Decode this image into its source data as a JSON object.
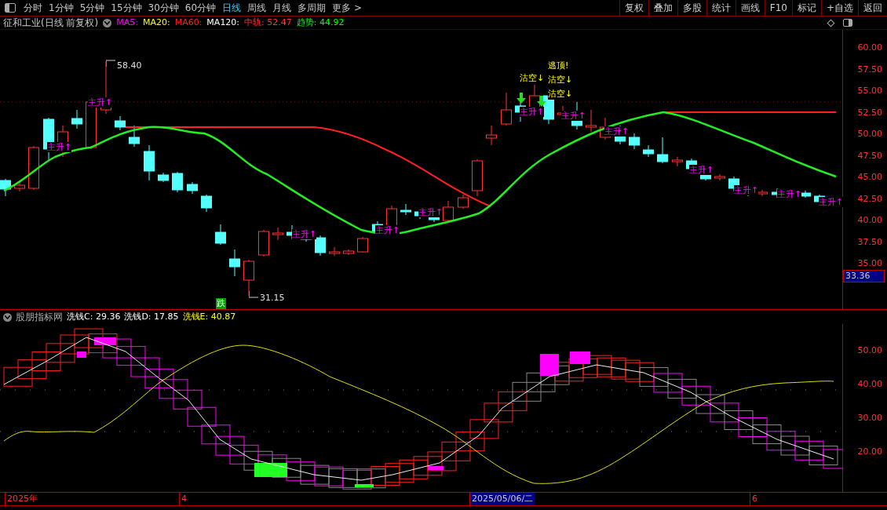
{
  "toolbar": {
    "periods": [
      {
        "label": "分时",
        "selected": false
      },
      {
        "label": "1分钟",
        "selected": false
      },
      {
        "label": "5分钟",
        "selected": false
      },
      {
        "label": "15分钟",
        "selected": false
      },
      {
        "label": "30分钟",
        "selected": false
      },
      {
        "label": "60分钟",
        "selected": false
      },
      {
        "label": "日线",
        "selected": true
      },
      {
        "label": "周线",
        "selected": false
      },
      {
        "label": "月线",
        "selected": false
      },
      {
        "label": "多周期",
        "selected": false
      }
    ],
    "more": "更多 >",
    "actions": [
      "复权",
      "叠加",
      "多股",
      "统计",
      "画线",
      "F10",
      "标记",
      "+自选",
      "返回"
    ]
  },
  "price_chart": {
    "title": "征和工业(日线 前复权)",
    "indicators": [
      {
        "label": "MA5:",
        "color": "#ff00ff"
      },
      {
        "label": "MA20:",
        "color": "#ffff00"
      },
      {
        "label": "MA60:",
        "color": "#ff2020"
      },
      {
        "label": "MA120:",
        "color": "#ffffff"
      },
      {
        "label": "中轨: 52.47",
        "color": "#ff3232"
      },
      {
        "label": "趋势: 44.92",
        "color": "#00ff00"
      }
    ],
    "axis": [
      "60.00",
      "57.50",
      "55.00",
      "52.50",
      "50.00",
      "47.50",
      "45.00",
      "42.50",
      "40.00",
      "37.50",
      "35.00"
    ],
    "current_price": "33.36",
    "high_label": "58.40",
    "low_label": "31.15",
    "signals": [
      {
        "text": "跌",
        "kind": "fall"
      },
      {
        "text": "逃顶!",
        "kind": "top"
      },
      {
        "text": "沽空↓",
        "kind": "short"
      },
      {
        "text": "沽空↓",
        "kind": "short"
      },
      {
        "text": "沽空↓",
        "kind": "short"
      }
    ],
    "trend_labels": [
      "主升↑",
      "主升↑",
      "主升↑",
      "主升↑",
      "主升↑",
      "主升↑",
      "主升↑",
      "主升↑",
      "主升↑",
      "主升↑",
      "主升↑",
      "主升↑"
    ]
  },
  "indicator_chart": {
    "name": "股朋指标网",
    "values": [
      {
        "label": "洗钱C: 29.36",
        "color": "#ffffff"
      },
      {
        "label": "洗钱D: 17.85",
        "color": "#ffffff"
      },
      {
        "label": "洗钱E: 40.87",
        "color": "#ffff00"
      }
    ],
    "axis": [
      "50.00",
      "40.00",
      "30.00",
      "20.00"
    ]
  },
  "date_bar": [
    {
      "label": "2025年",
      "selected": false
    },
    {
      "label": "4",
      "selected": false
    },
    {
      "label": "2025/05/06/二",
      "selected": true
    },
    {
      "label": "6",
      "selected": false
    }
  ]
}
